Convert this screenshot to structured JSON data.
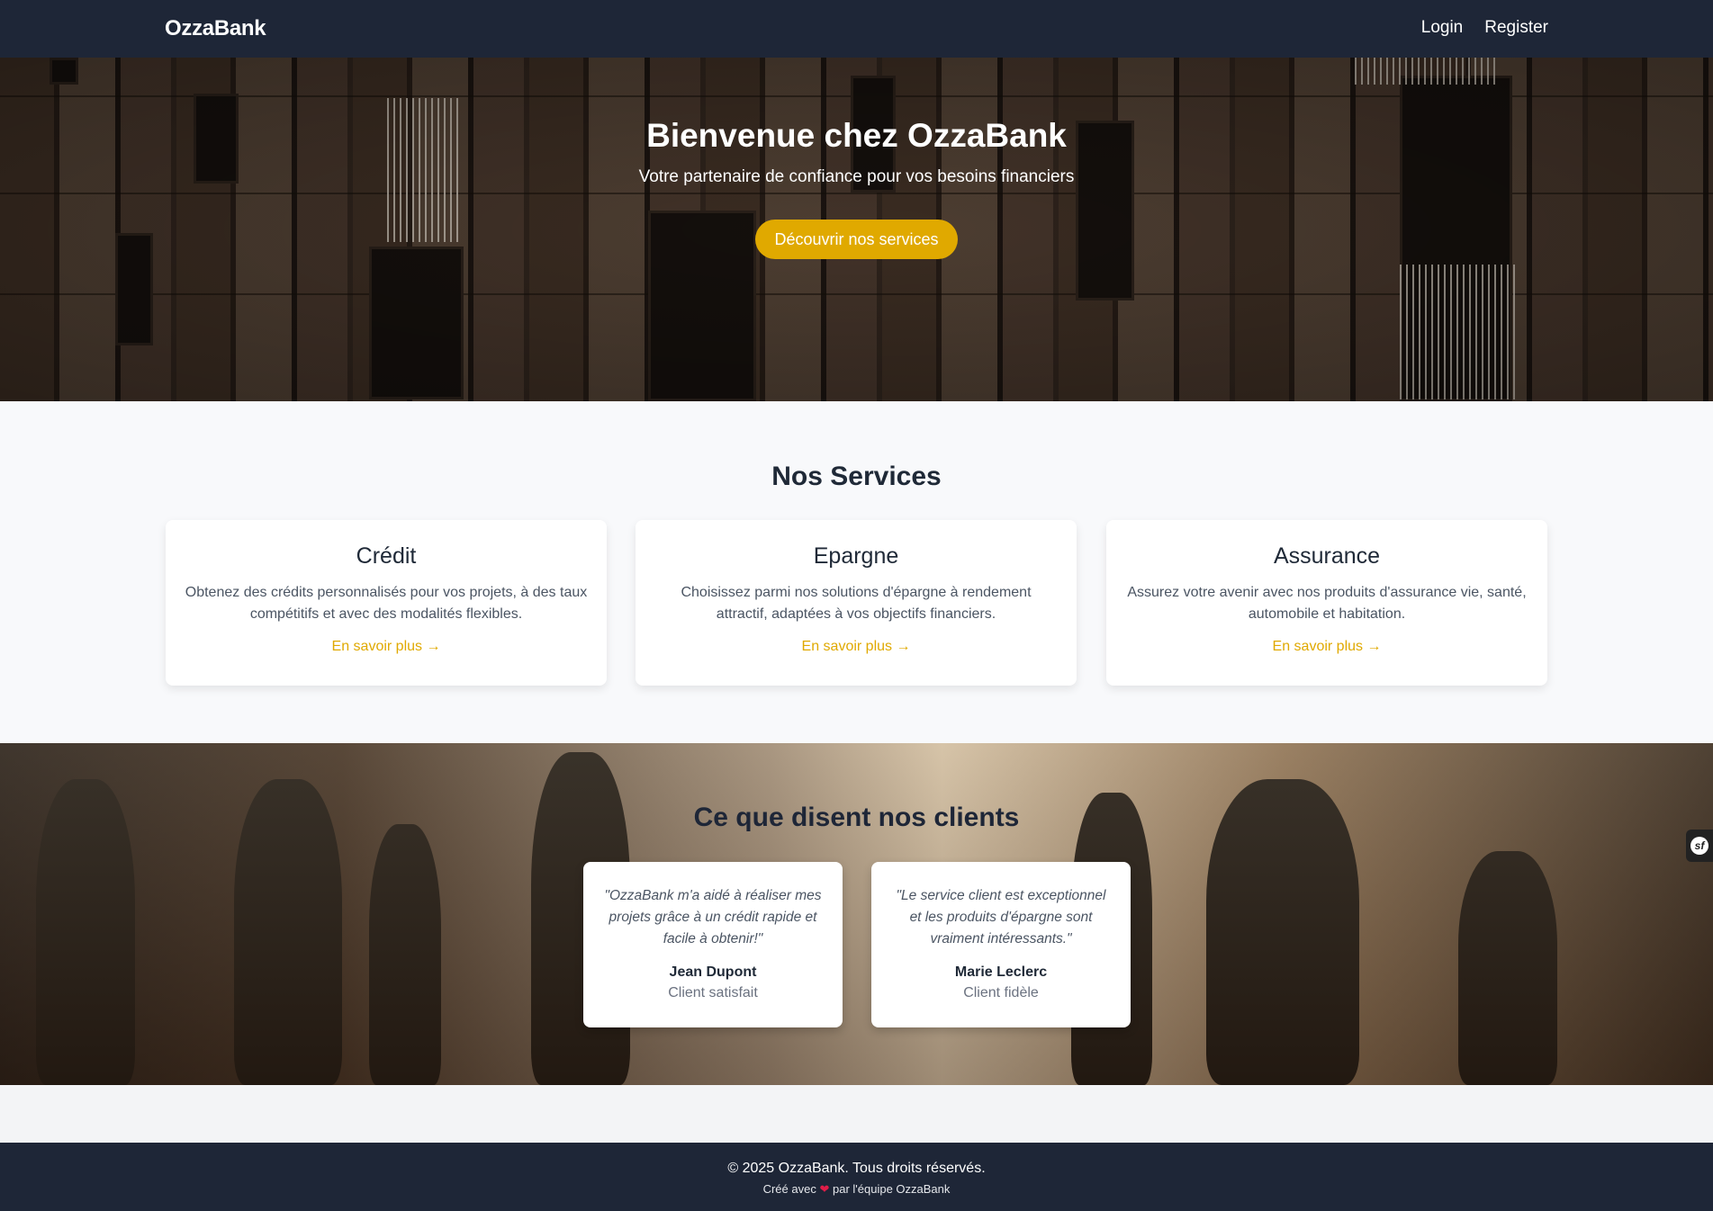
{
  "navbar": {
    "brand": "OzzaBank",
    "links": [
      "Login",
      "Register"
    ]
  },
  "hero": {
    "title": "Bienvenue chez OzzaBank",
    "subtitle": "Votre partenaire de confiance pour vos besoins financiers",
    "cta_label": "Découvrir nos services"
  },
  "services": {
    "title": "Nos Services",
    "cards": [
      {
        "title": "Crédit",
        "description": "Obtenez des crédits personnalisés pour vos projets, à des taux compétitifs et avec des modalités flexibles.",
        "link": "En savoir plus →"
      },
      {
        "title": "Epargne",
        "description": "Choisissez parmi nos solutions d'épargne à rendement attractif, adaptées à vos objectifs financiers.",
        "link": "En savoir plus →"
      },
      {
        "title": "Assurance",
        "description": "Assurez votre avenir avec nos produits d'assurance vie, santé, automobile et habitation.",
        "link": "En savoir plus →"
      }
    ]
  },
  "testimonials": {
    "title": "Ce que disent nos clients",
    "items": [
      {
        "quote": "\"OzzaBank m'a aidé à réaliser mes projets grâce à un crédit rapide et facile à obtenir!\"",
        "author": "Jean Dupont",
        "role": "Client satisfait"
      },
      {
        "quote": "\"Le service client est exceptionnel et les produits d'épargne sont vraiment intéressants.\"",
        "author": "Marie Leclerc",
        "role": "Client fidèle"
      }
    ]
  },
  "debug_toolbar": {
    "label": "sf"
  },
  "footer": {
    "copyright": "© 2025 OzzaBank. Tous droits réservés.",
    "made_prefix": "Créé avec",
    "heart": "❤",
    "made_suffix": "par l'équipe OzzaBank"
  },
  "colors": {
    "nav_bg": "#1e2637",
    "accent": "#e0a900",
    "services_bg": "#f8f9fb"
  }
}
